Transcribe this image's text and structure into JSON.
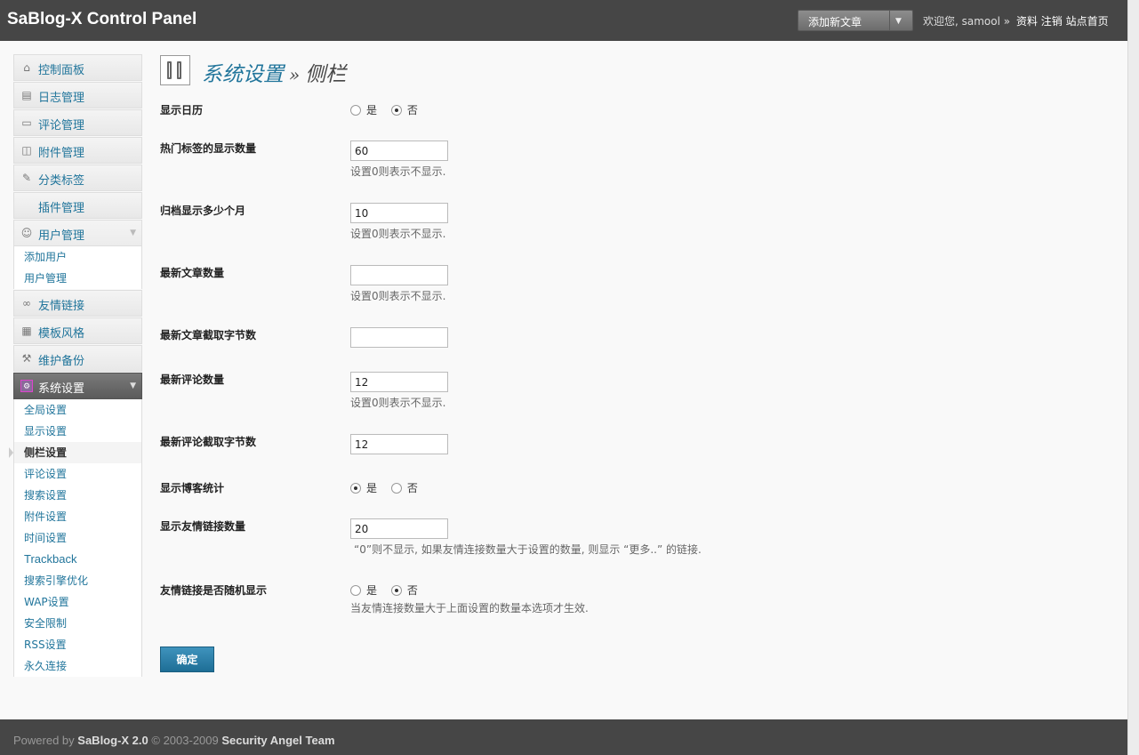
{
  "header": {
    "brand": "SaBlog-X Control Panel",
    "quick_action": "添加新文章",
    "greeting": "欢迎您, samool »",
    "links": [
      "资料",
      "注销",
      "站点首页"
    ]
  },
  "sidebar": {
    "items": [
      {
        "label": "控制面板",
        "icon": "home-icon"
      },
      {
        "label": "日志管理",
        "icon": "posts-icon"
      },
      {
        "label": "评论管理",
        "icon": "comments-icon"
      },
      {
        "label": "附件管理",
        "icon": "media-icon"
      },
      {
        "label": "分类标签",
        "icon": "tags-icon"
      },
      {
        "label": "插件管理",
        "icon": ""
      },
      {
        "label": "用户管理",
        "icon": "users-icon"
      },
      {
        "label": "友情链接",
        "icon": "links-icon"
      },
      {
        "label": "模板风格",
        "icon": "appearance-icon"
      },
      {
        "label": "维护备份",
        "icon": "tools-icon"
      },
      {
        "label": "系统设置",
        "icon": "settings-icon"
      }
    ],
    "user_sub": [
      "添加用户",
      "用户管理"
    ],
    "settings_sub": [
      "全局设置",
      "显示设置",
      "侧栏设置",
      "评论设置",
      "搜索设置",
      "附件设置",
      "时间设置",
      "Trackback",
      "搜索引擎优化",
      "WAP设置",
      "安全限制",
      "RSS设置",
      "永久连接"
    ],
    "current": "侧栏设置"
  },
  "page": {
    "title_link": "系统设置",
    "title_sep": "»",
    "title_current": "侧栏"
  },
  "form": {
    "radio_yes": "是",
    "radio_no": "否",
    "show_calendar": {
      "label": "显示日历",
      "value": "否"
    },
    "hot_tags": {
      "label": "热门标签的显示数量",
      "value": "60",
      "hint": "设置0则表示不显示."
    },
    "archive_months": {
      "label": "归档显示多少个月",
      "value": "10",
      "hint": "设置0则表示不显示."
    },
    "recent_posts": {
      "label": "最新文章数量",
      "value": "",
      "hint": "设置0则表示不显示."
    },
    "recent_posts_bytes": {
      "label": "最新文章截取字节数",
      "value": ""
    },
    "recent_comments": {
      "label": "最新评论数量",
      "value": "12",
      "hint": "设置0则表示不显示."
    },
    "recent_comments_bytes": {
      "label": "最新评论截取字节数",
      "value": "12"
    },
    "show_stats": {
      "label": "显示博客统计",
      "value": "是"
    },
    "links_count": {
      "label": "显示友情链接数量",
      "value": "20",
      "hint": "“0”则不显示, 如果友情连接数量大于设置的数量, 则显示 “更多..” 的链接."
    },
    "links_random": {
      "label": "友情链接是否随机显示",
      "value": "否",
      "hint": "当友情连接数量大于上面设置的数量本选项才生效."
    },
    "submit": "确定"
  },
  "footer": {
    "prefix": "Powered by",
    "product": "SaBlog-X 2.0",
    "copyright": "© 2003-2009",
    "team": "Security Angel Team"
  }
}
